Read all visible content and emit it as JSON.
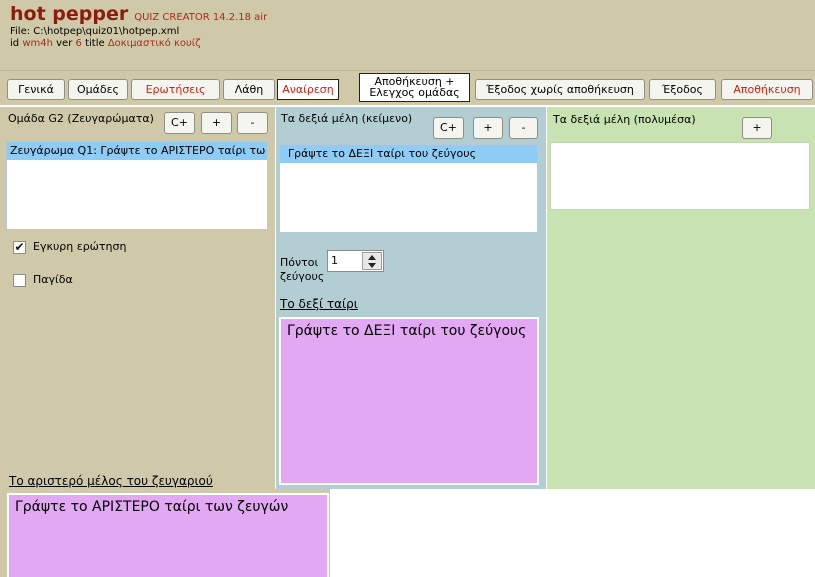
{
  "header": {
    "app_name": "hot pepper",
    "version": "QUIZ CREATOR 14.2.18 air",
    "file_path": "File: C:\\hotpep\\quiz01\\hotpep.xml",
    "id_label": "id",
    "id_value": "wm4h",
    "ver_label": "ver",
    "ver_value": "6",
    "title_label": "title",
    "title_value": "Δοκιμαστικό κουίζ"
  },
  "toolbar": {
    "general": "Γενικά",
    "groups": "Ομάδες",
    "questions": "Ερωτήσεις",
    "errors": "Λάθη",
    "undo": "Αναίρεση",
    "save_check_line1": "Αποθήκευση +",
    "save_check_line2": "Ελεγχος ομάδας",
    "exit_no_save": "Έξοδος χωρίς αποθήκευση",
    "exit": "Έξοδος",
    "save": "Αποθήκευση"
  },
  "left": {
    "group_title": "Ομάδα G2 (Ζευγαρώματα)",
    "btn_copy": "C+",
    "btn_add": "+",
    "btn_remove": "-",
    "list_selected": "Ζευγάρωμα Q1: Γράψτε το ΑΡΙΣΤΕΡΟ ταίρι τω",
    "valid_label": "Εγκυρη ερώτηση",
    "trap_label": "Παγίδα",
    "left_member_title": "Το αριστερό μέλος του ζευγαριού",
    "left_member_text": "Γράψτε το ΑΡΙΣΤΕΡΟ ταίρι των ζευγών"
  },
  "middle": {
    "title": "Τα δεξιά μέλη (κείμενο)",
    "btn_copy": "C+",
    "btn_add": "+",
    "btn_remove": "-",
    "list_selected": "Γράψτε το ΔΕΞΙ ταίρι του ζεύγους",
    "points_label_line1": "Πόντοι",
    "points_label_line2": "ζεύγους",
    "points_value": "1",
    "right_pair_title": "Το δεξί ταίρι",
    "right_pair_text": "Γράψτε το ΔΕΞΙ ταίρι του ζεύγους"
  },
  "right": {
    "title": "Τα δεξιά μέλη (πολυμέσα)",
    "btn_add": "+"
  },
  "state": {
    "valid_checked": true,
    "trap_checked": false
  }
}
